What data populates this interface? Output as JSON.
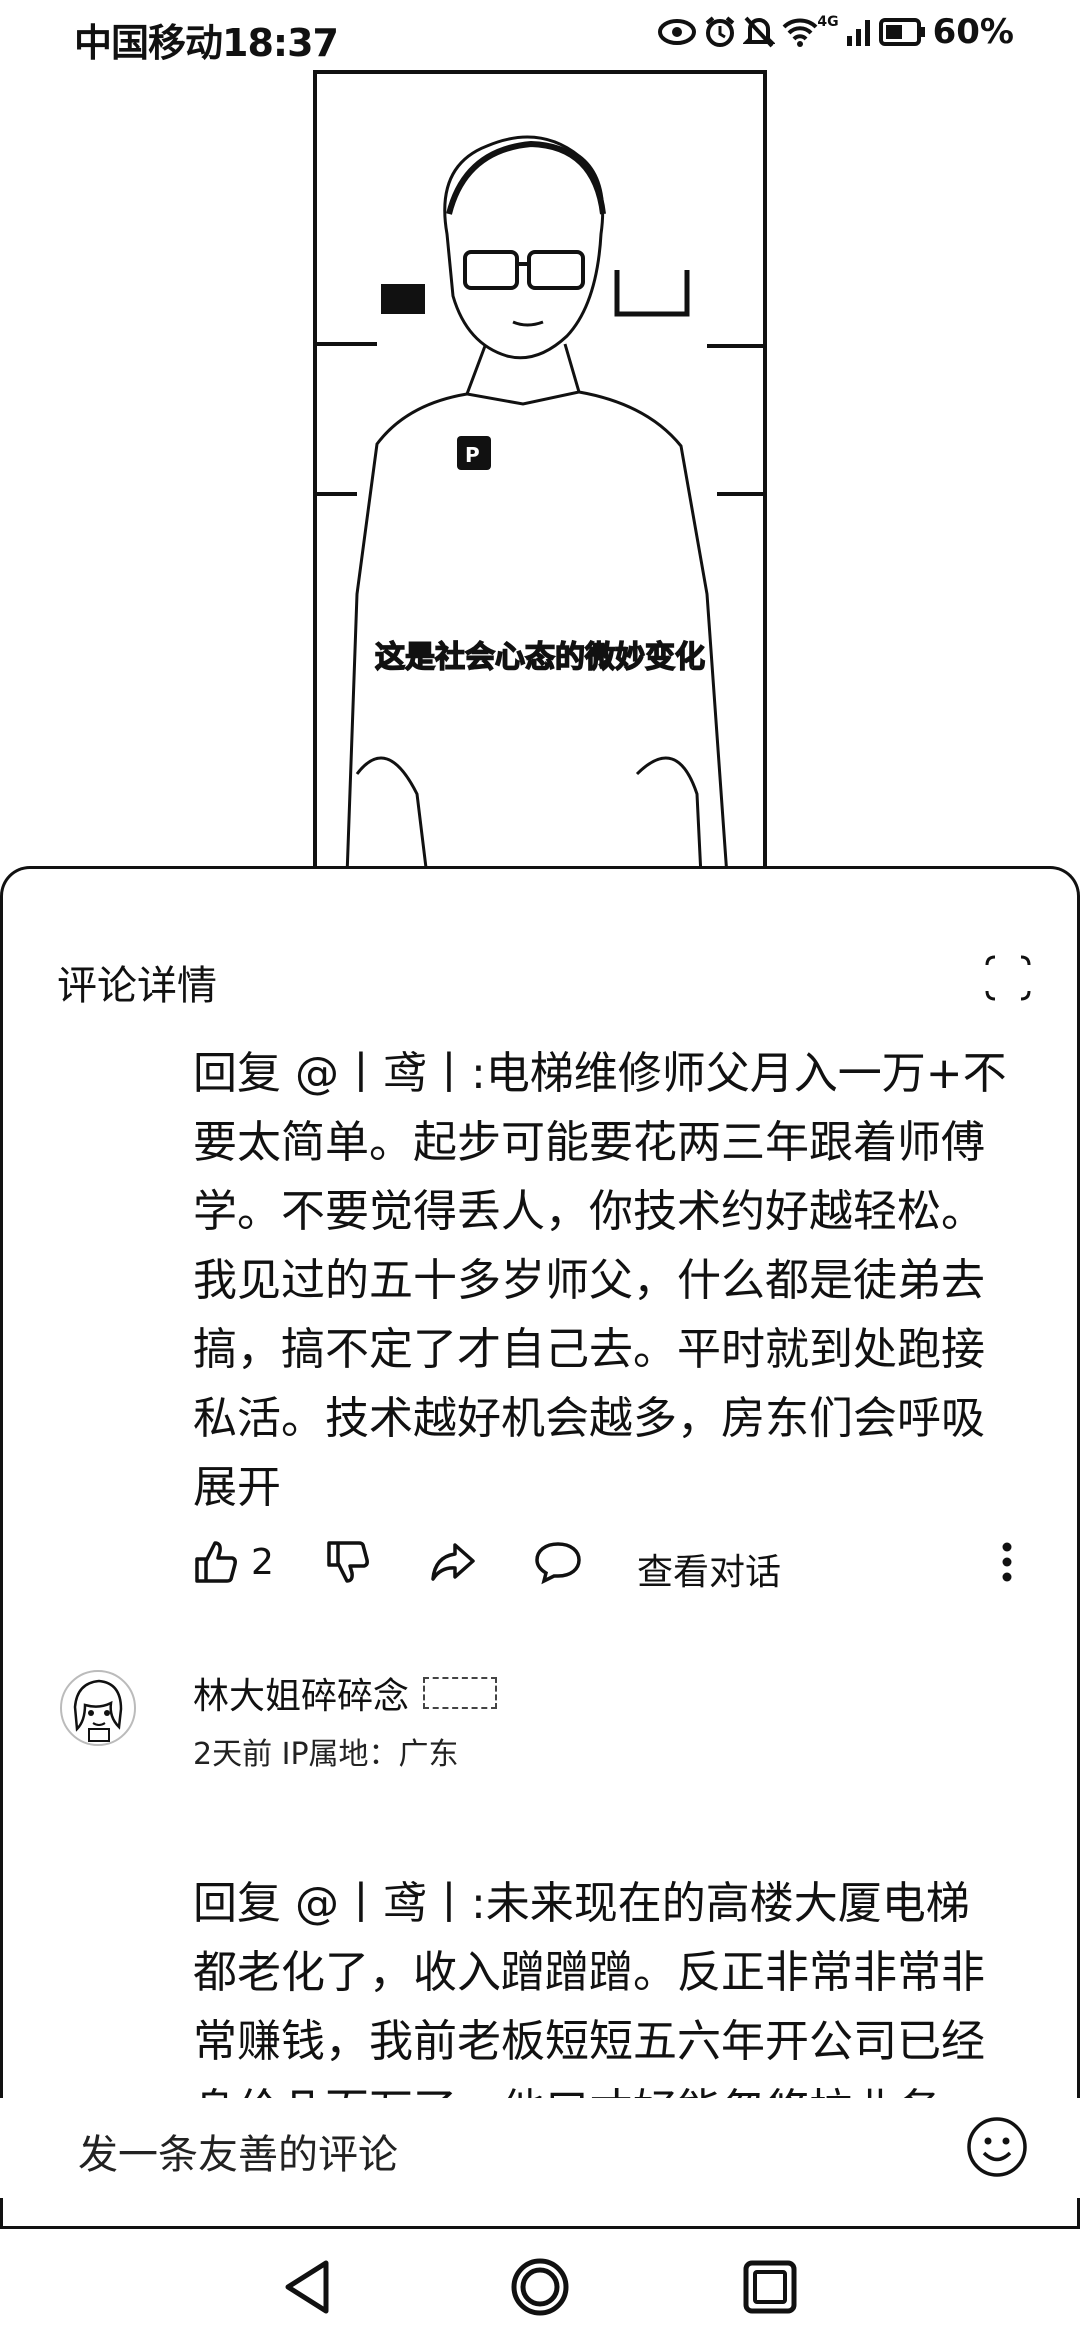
{
  "status_bar": {
    "carrier": "中国移动",
    "time": "18:37",
    "network": "4G",
    "battery": "60%"
  },
  "video": {
    "watermark": "",
    "subtitle": "这是社会心态的微妙变化"
  },
  "sheet": {
    "title": "评论详情",
    "close_icon": "collapse-corners-icon"
  },
  "comments": [
    {
      "lines": [
        "回复 @丨鸢丨:电梯维修师父月入一万+不",
        "要太简单。起步可能要花两三年跟着师傅",
        "学。不要觉得丢人，你技术约好越轻松。",
        "我见过的五十多岁师父，什么都是徒弟去",
        "搞，搞不定了才自己去。平时就到处跑接",
        "私活。技术越好机会越多，房东们会呼吸"
      ],
      "expand_label": "展开",
      "likes": "2",
      "view_conversation": "查看对话"
    },
    {
      "author": "林大姐碎碎念",
      "badge": "",
      "meta": "2天前  IP属地：广东",
      "lines": [
        "回复 @丨鸢丨:未来现在的高楼大厦电梯",
        "都老化了，收入蹭蹭蹭。反正非常非常非",
        "常赚钱，我前老板短短五六年开公司已经",
        "身价几百万了。他口才好能忽悠拉业务，"
      ]
    }
  ],
  "input": {
    "placeholder": "发一条友善的评论",
    "emoji_icon": "smiley-icon"
  },
  "nav": {
    "back_icon": "back-triangle-icon",
    "home_icon": "home-circle-icon",
    "recents_icon": "recents-square-icon"
  }
}
